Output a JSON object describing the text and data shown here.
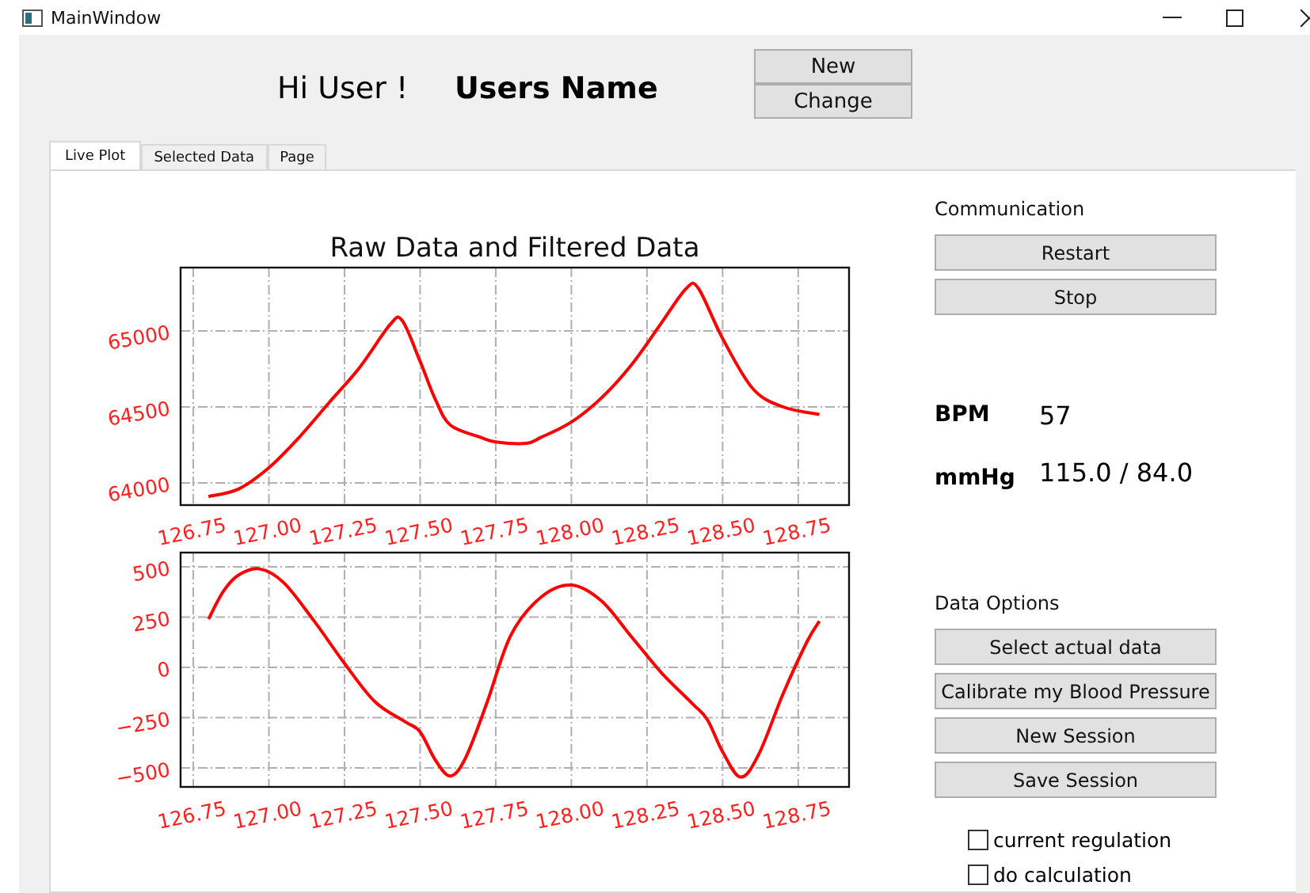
{
  "window": {
    "title": "MainWindow"
  },
  "header": {
    "greeting": "Hi User !",
    "user_name": "Users Name",
    "buttons": [
      "New",
      "Change"
    ]
  },
  "tabs": [
    {
      "label": "Live Plot",
      "selected": true
    },
    {
      "label": "Selected Data",
      "selected": false
    },
    {
      "label": "Page",
      "selected": false
    }
  ],
  "plots": [
    {
      "chart_data": {
        "type": "line",
        "title": "Raw Data and Filtered Data",
        "xlim": [
          126.708,
          128.918
        ],
        "ylim": [
          63854,
          65417
        ],
        "xticks": [
          {
            "value": 126.75,
            "label": "126.75"
          },
          {
            "value": 127.0,
            "label": "127.00"
          },
          {
            "value": 127.25,
            "label": "127.25"
          },
          {
            "value": 127.5,
            "label": "127.50"
          },
          {
            "value": 127.75,
            "label": "127.75"
          },
          {
            "value": 128.0,
            "label": "128.00"
          },
          {
            "value": 128.25,
            "label": "128.25"
          },
          {
            "value": 128.5,
            "label": "128.50"
          },
          {
            "value": 128.75,
            "label": "128.75"
          }
        ],
        "yticks": [
          64000,
          64500,
          65000
        ],
        "x": [
          126.8,
          126.9,
          127.0,
          127.1,
          127.2,
          127.3,
          127.4,
          127.44,
          127.5,
          127.55,
          127.6,
          127.7,
          127.75,
          127.85,
          127.9,
          128.0,
          128.1,
          128.2,
          128.3,
          128.38,
          128.42,
          128.5,
          128.6,
          128.7,
          128.82
        ],
        "grid": true,
        "series": [
          {
            "color": "#ff0000",
            "values": [
              63910,
              63960,
              64100,
              64300,
              64530,
              64760,
              65040,
              65070,
              64800,
              64550,
              64380,
              64300,
              64270,
              64260,
              64300,
              64400,
              64560,
              64780,
              65060,
              65280,
              65280,
              64950,
              64620,
              64500,
              64450
            ]
          }
        ]
      }
    },
    {
      "chart_data": {
        "type": "line",
        "xlim": [
          126.708,
          128.918
        ],
        "ylim": [
          -594,
          571
        ],
        "xticks": [
          {
            "value": 126.75,
            "label": "126.75"
          },
          {
            "value": 127.0,
            "label": "127.00"
          },
          {
            "value": 127.25,
            "label": "127.25"
          },
          {
            "value": 127.5,
            "label": "127.50"
          },
          {
            "value": 127.75,
            "label": "127.75"
          },
          {
            "value": 128.0,
            "label": "128.00"
          },
          {
            "value": 128.25,
            "label": "128.25"
          },
          {
            "value": 128.5,
            "label": "128.50"
          },
          {
            "value": 128.75,
            "label": "128.75"
          }
        ],
        "yticks": [
          {
            "value": -500,
            "label": "−500"
          },
          {
            "value": -250,
            "label": "−250"
          },
          {
            "value": 0,
            "label": "0"
          },
          {
            "value": 250,
            "label": "250"
          },
          {
            "value": 500,
            "label": "500"
          }
        ],
        "x": [
          126.8,
          126.85,
          126.9,
          126.97,
          127.05,
          127.15,
          127.25,
          127.35,
          127.45,
          127.5,
          127.55,
          127.6,
          127.65,
          127.72,
          127.8,
          127.9,
          128.0,
          128.1,
          128.2,
          128.3,
          128.4,
          128.45,
          128.5,
          128.56,
          128.62,
          128.7,
          128.78,
          128.82
        ],
        "grid": true,
        "series": [
          {
            "color": "#ff0000",
            "values": [
              240,
              380,
              460,
              490,
              420,
              230,
              20,
              -170,
              -270,
              -320,
              -460,
              -540,
              -450,
              -180,
              160,
              350,
              410,
              330,
              150,
              -30,
              -180,
              -260,
              -420,
              -545,
              -430,
              -130,
              130,
              230
            ]
          }
        ]
      }
    }
  ],
  "communication": {
    "label": "Communication",
    "buttons": [
      "Restart",
      "Stop"
    ]
  },
  "readings": [
    {
      "label": "BPM",
      "value": "57"
    },
    {
      "label": "mmHg",
      "value": "115.0 / 84.0"
    }
  ],
  "data_options": {
    "label": "Data Options",
    "buttons": [
      "Select actual data",
      "Calibrate my Blood Pressure",
      "New Session",
      "Save Session"
    ]
  },
  "checkboxes": [
    {
      "label": "current regulation",
      "checked": false
    },
    {
      "label": "do calculation",
      "checked": false
    }
  ]
}
